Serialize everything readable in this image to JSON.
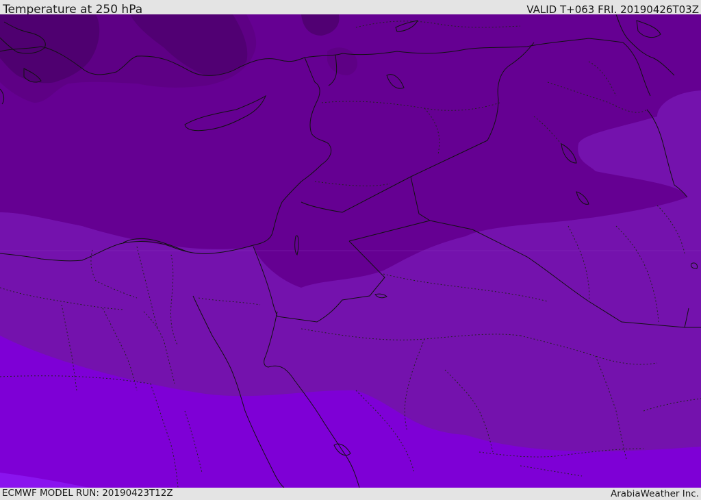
{
  "header": {
    "title": "Temperature at 250 hPa",
    "valid_time": "VALID T+063 FRI. 20190426T03Z"
  },
  "footer": {
    "model_run": "ECMWF MODEL RUN: 20190423T12Z",
    "credit": "ArabiaWeather Inc."
  },
  "map": {
    "field": "Temperature at 250 hPa",
    "colors": {
      "coldest": "#4f0070",
      "cold": "#5e0085",
      "mid_cold": "#650092",
      "mid": "#7412ad",
      "warm": "#7e00d6",
      "warmest": "#8a14ee"
    }
  }
}
